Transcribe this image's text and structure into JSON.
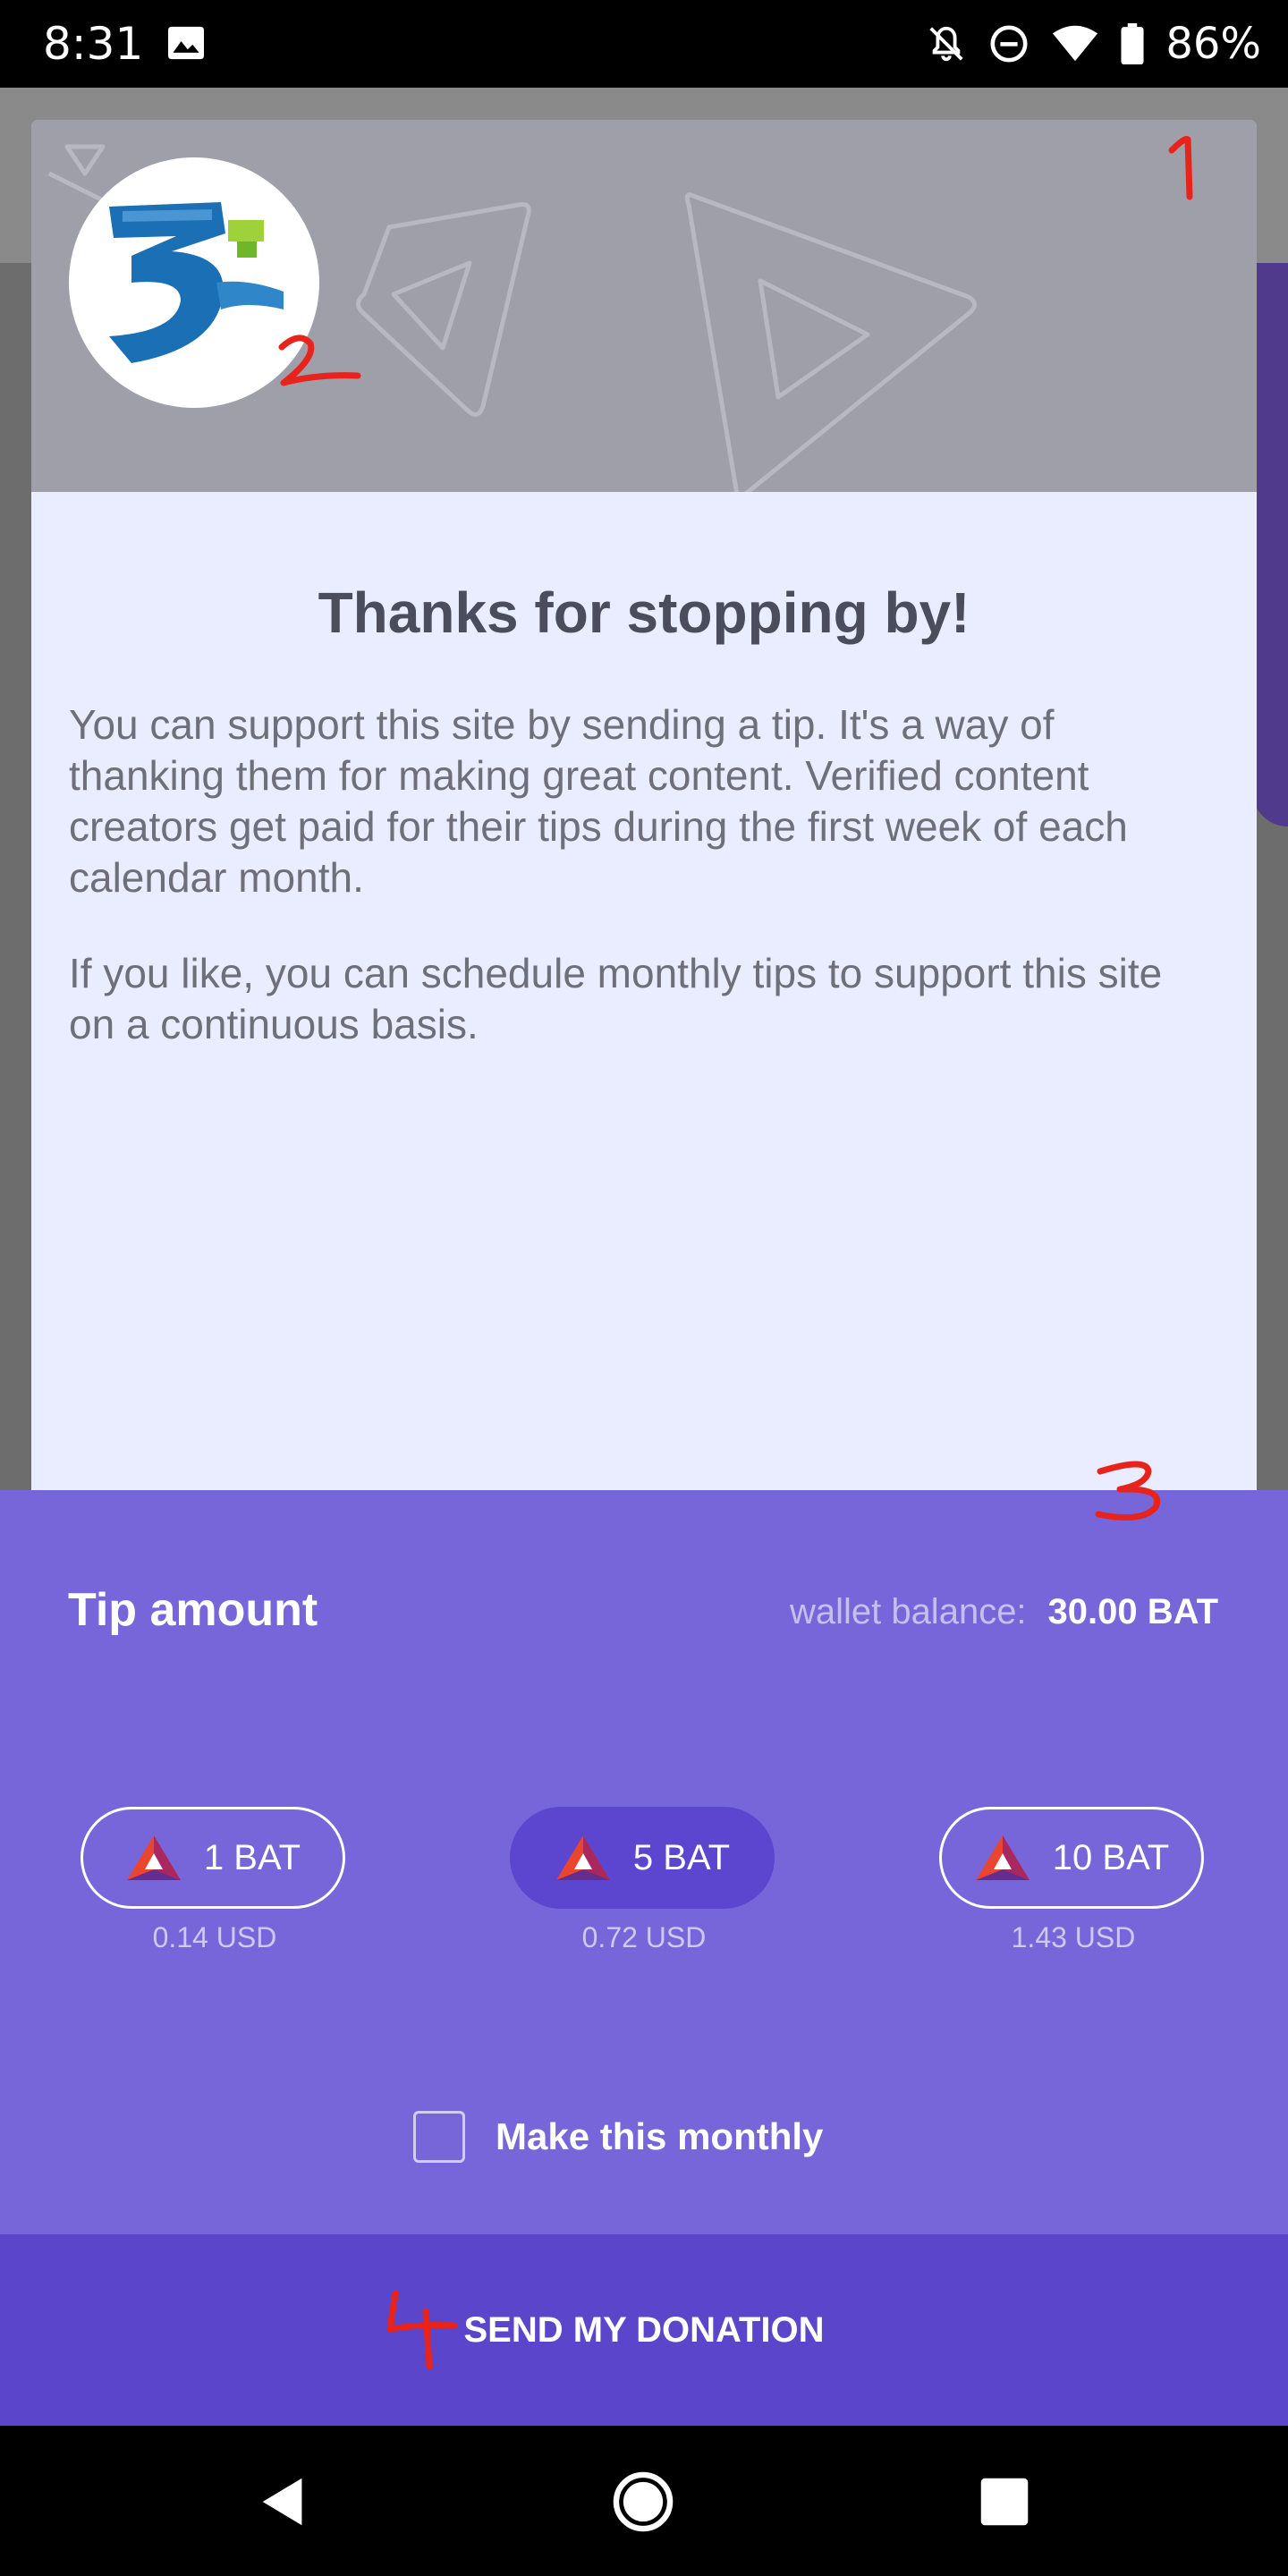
{
  "status_bar": {
    "time": "8:31",
    "battery": "86%",
    "icons": [
      "gallery-icon",
      "notifications-off-icon",
      "do-not-disturb-icon",
      "wifi-icon",
      "battery-icon"
    ]
  },
  "dialog": {
    "title": "Thanks for stopping by!",
    "paragraph_1": "You can support this site by sending a tip. It's a way of thanking them for making great content. Verified content creators get paid for their tips during the first week of each calendar month.",
    "paragraph_2": "If you like, you can schedule monthly tips to support this site on a continuous basis."
  },
  "tip_panel": {
    "title": "Tip amount",
    "wallet_label": "wallet balance:",
    "wallet_value": "30.00 BAT",
    "amounts": [
      {
        "label": "1 BAT",
        "usd": "0.14 USD",
        "selected": false
      },
      {
        "label": "5 BAT",
        "usd": "0.72 USD",
        "selected": true
      },
      {
        "label": "10 BAT",
        "usd": "1.43 USD",
        "selected": false
      }
    ],
    "monthly_label": "Make this monthly",
    "monthly_checked": false
  },
  "send_button": "SEND MY DONATION",
  "annotations": [
    "1",
    "2",
    "3",
    "4"
  ],
  "colors": {
    "panel": "#7766d9",
    "send_button": "#5b45ca",
    "selected_amount": "#5c46cf",
    "annotation": "#e8231c"
  }
}
